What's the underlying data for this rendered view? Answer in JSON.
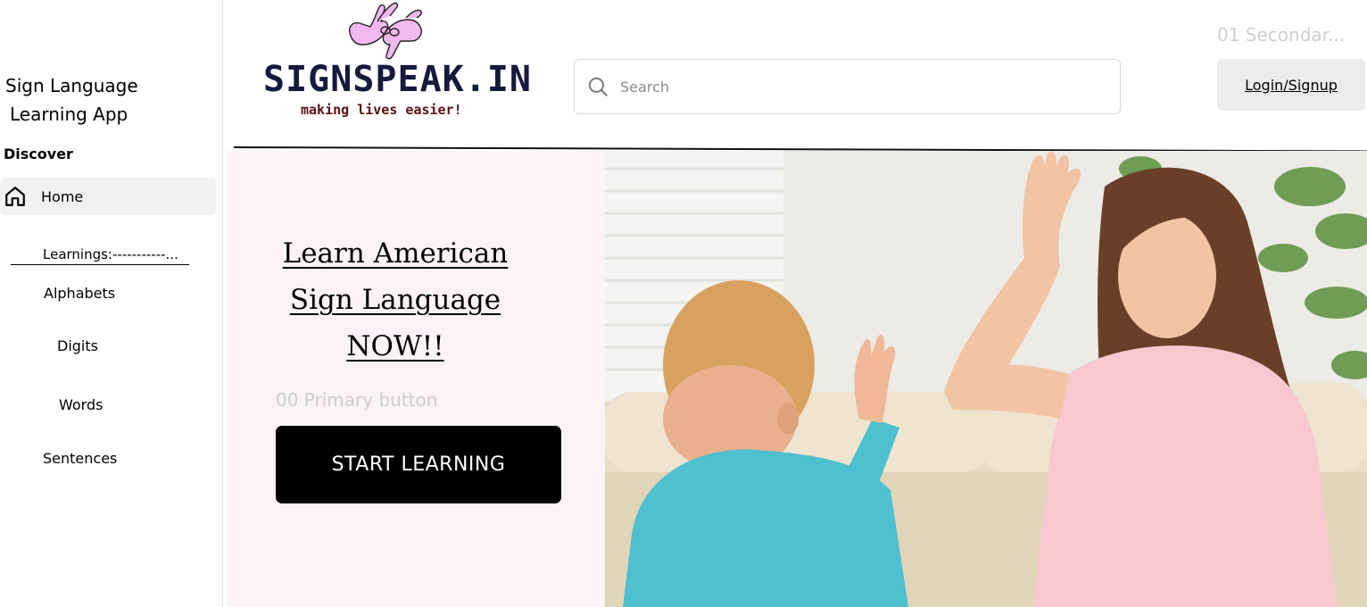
{
  "sidebar": {
    "app_title_line1": "Sign Language",
    "app_title_line2": "Learning App",
    "discover_label": "Discover",
    "home_label": "Home",
    "learnings_label": "Learnings:-----------...",
    "links": [
      "Alphabets",
      "Digits",
      "Words",
      "Sentences"
    ]
  },
  "header": {
    "brand": "SIGNSPEAK.IN",
    "tagline": "making lives easier!",
    "search_placeholder": "Search",
    "secondary_tag": "01 Secondar...",
    "login_label": "Login/Signup"
  },
  "hero": {
    "title_line1": "Learn American",
    "title_line2": " Sign Language",
    "title_line3": "NOW!!",
    "primary_tag": "00 Primary button",
    "cta_label": "START LEARNING"
  },
  "colors": {
    "hero_bg": "#fdf3f4",
    "brand_text": "#151a3d",
    "tagline_text": "#5a0f14",
    "cta_bg": "#000000",
    "login_bg": "#ececec"
  },
  "icons": {
    "home": "home-icon",
    "search": "search-icon",
    "logo": "signing-hands-logo"
  }
}
